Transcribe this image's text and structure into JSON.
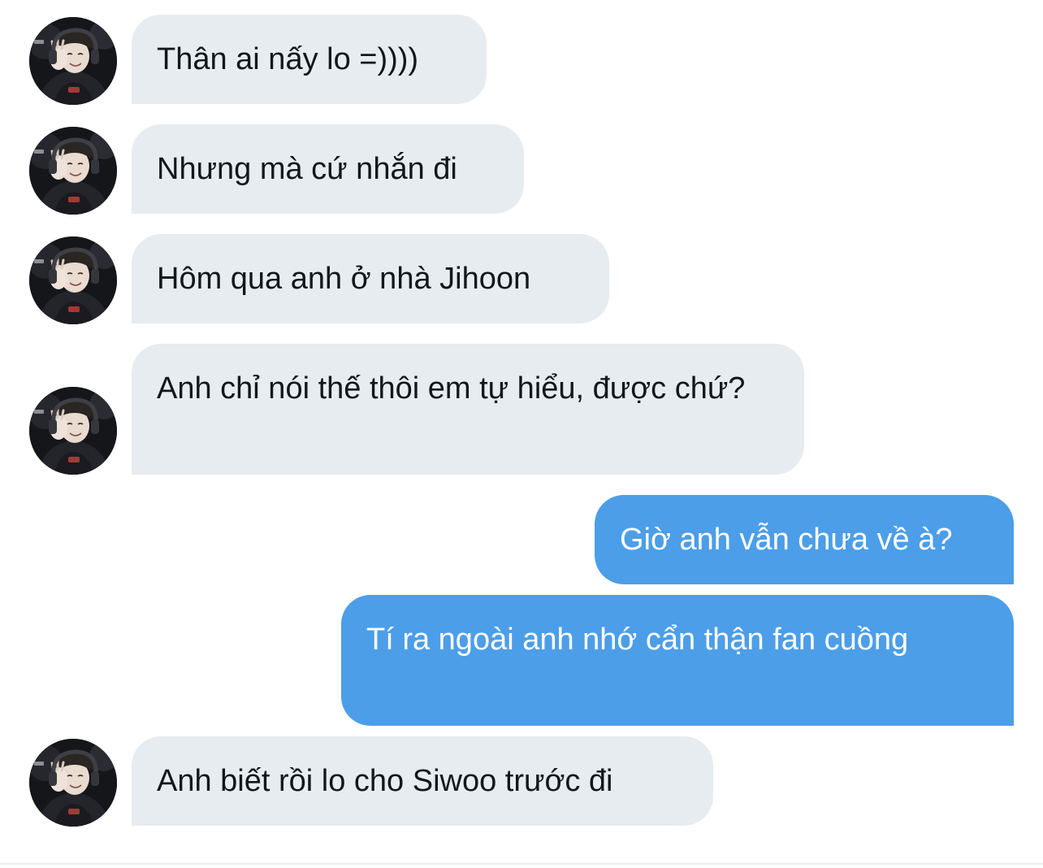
{
  "conversation": {
    "messages": [
      {
        "direction": "incoming",
        "text": "Thân ai nấy lo =))))"
      },
      {
        "direction": "incoming",
        "text": "Nhưng mà cứ nhắn đi"
      },
      {
        "direction": "incoming",
        "text": "Hôm qua anh ở nhà Jihoon"
      },
      {
        "direction": "incoming",
        "text": "Anh chỉ nói thế thôi em tự hiểu, được chứ?"
      },
      {
        "direction": "outgoing",
        "text": "Giờ anh vẫn chưa về à?"
      },
      {
        "direction": "outgoing",
        "text": "Tí ra ngoài anh nhớ cẩn thận fan cuồng"
      },
      {
        "direction": "incoming",
        "text": "Anh biết rồi lo cho Siwoo trước đi"
      }
    ]
  },
  "avatar_icon": "contact-avatar-photo",
  "colors": {
    "incoming_bubble": "#e6ecf0",
    "incoming_text": "#14171a",
    "outgoing_bubble": "#4c9ee8",
    "outgoing_text": "#ffffff"
  }
}
